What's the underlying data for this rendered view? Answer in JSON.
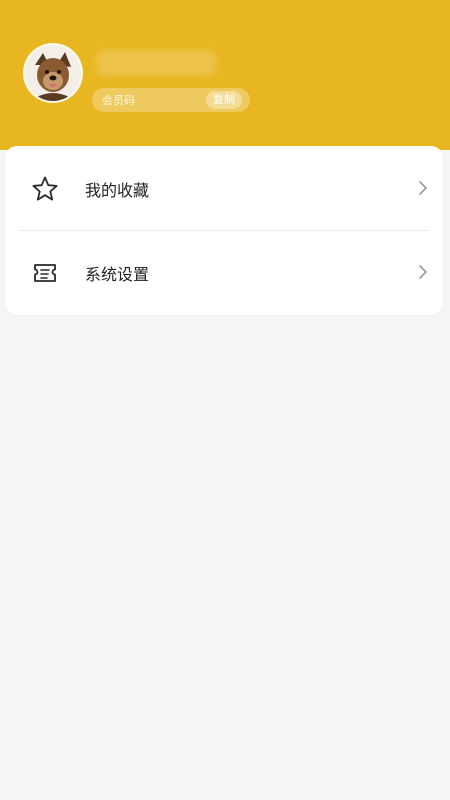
{
  "header": {
    "member_label": "会员码",
    "copy_label": "复制",
    "background_color": "#e8b620"
  },
  "menu": {
    "items": [
      {
        "label": "我的收藏",
        "icon": "star-icon"
      },
      {
        "label": "系统设置",
        "icon": "ticket-icon"
      }
    ]
  }
}
